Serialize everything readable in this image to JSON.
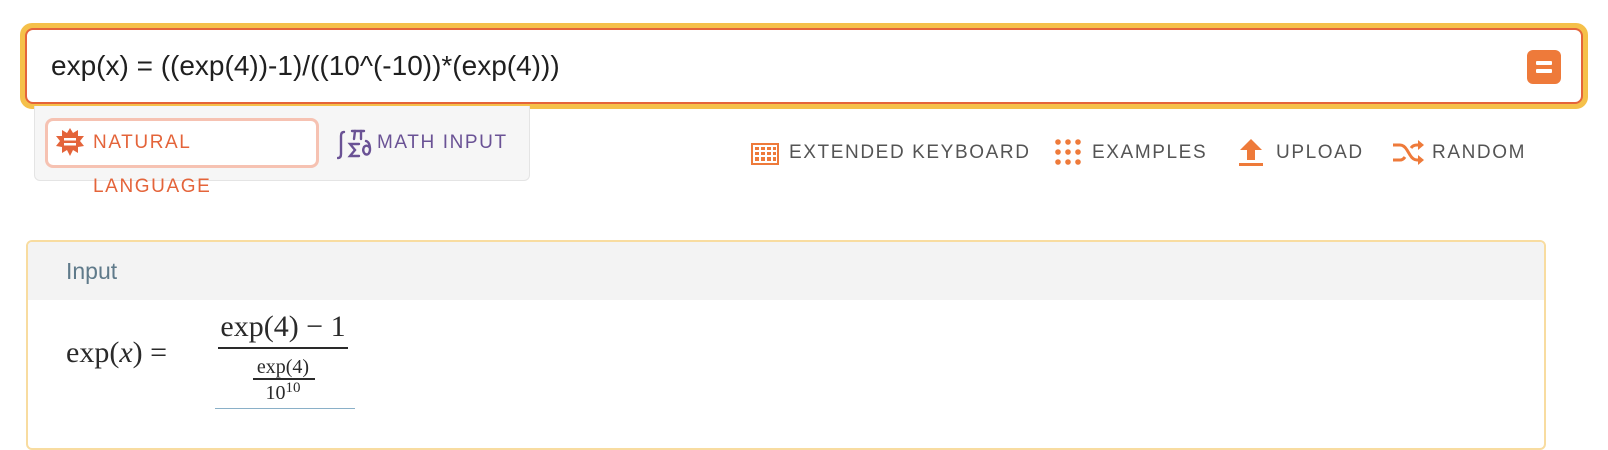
{
  "search": {
    "query": "exp(x) = ((exp(4))-1)/((10^(-10))*(exp(4)))",
    "compute_icon": "equals-icon",
    "accent_color": "#e4643a",
    "focus_ring_color": "#f5c04a"
  },
  "mode_tabs": {
    "natural_language": {
      "label": "NATURAL LANGUAGE",
      "icon": "sun-equals-icon",
      "selected": true,
      "color": "#e4643a"
    },
    "math_input": {
      "label": "MATH INPUT",
      "icon": "pi-sigma-icon",
      "selected": false,
      "color": "#6a5295"
    }
  },
  "toolbar": {
    "extended_keyboard": {
      "label": "EXTENDED KEYBOARD",
      "icon": "keyboard-grid-icon"
    },
    "examples": {
      "label": "EXAMPLES",
      "icon": "dots-grid-icon"
    },
    "upload": {
      "label": "UPLOAD",
      "icon": "upload-arrow-icon"
    },
    "random": {
      "label": "RANDOM",
      "icon": "shuffle-icon"
    },
    "icon_color": "#ee7a3a"
  },
  "pod": {
    "title": "Input",
    "math": {
      "lhs_func": "exp(",
      "lhs_var": "x",
      "lhs_close": ") =",
      "numerator": "exp(4) − 1",
      "inner_numerator": "exp(4)",
      "inner_denominator_base": "10",
      "inner_denominator_exp": "10"
    }
  }
}
